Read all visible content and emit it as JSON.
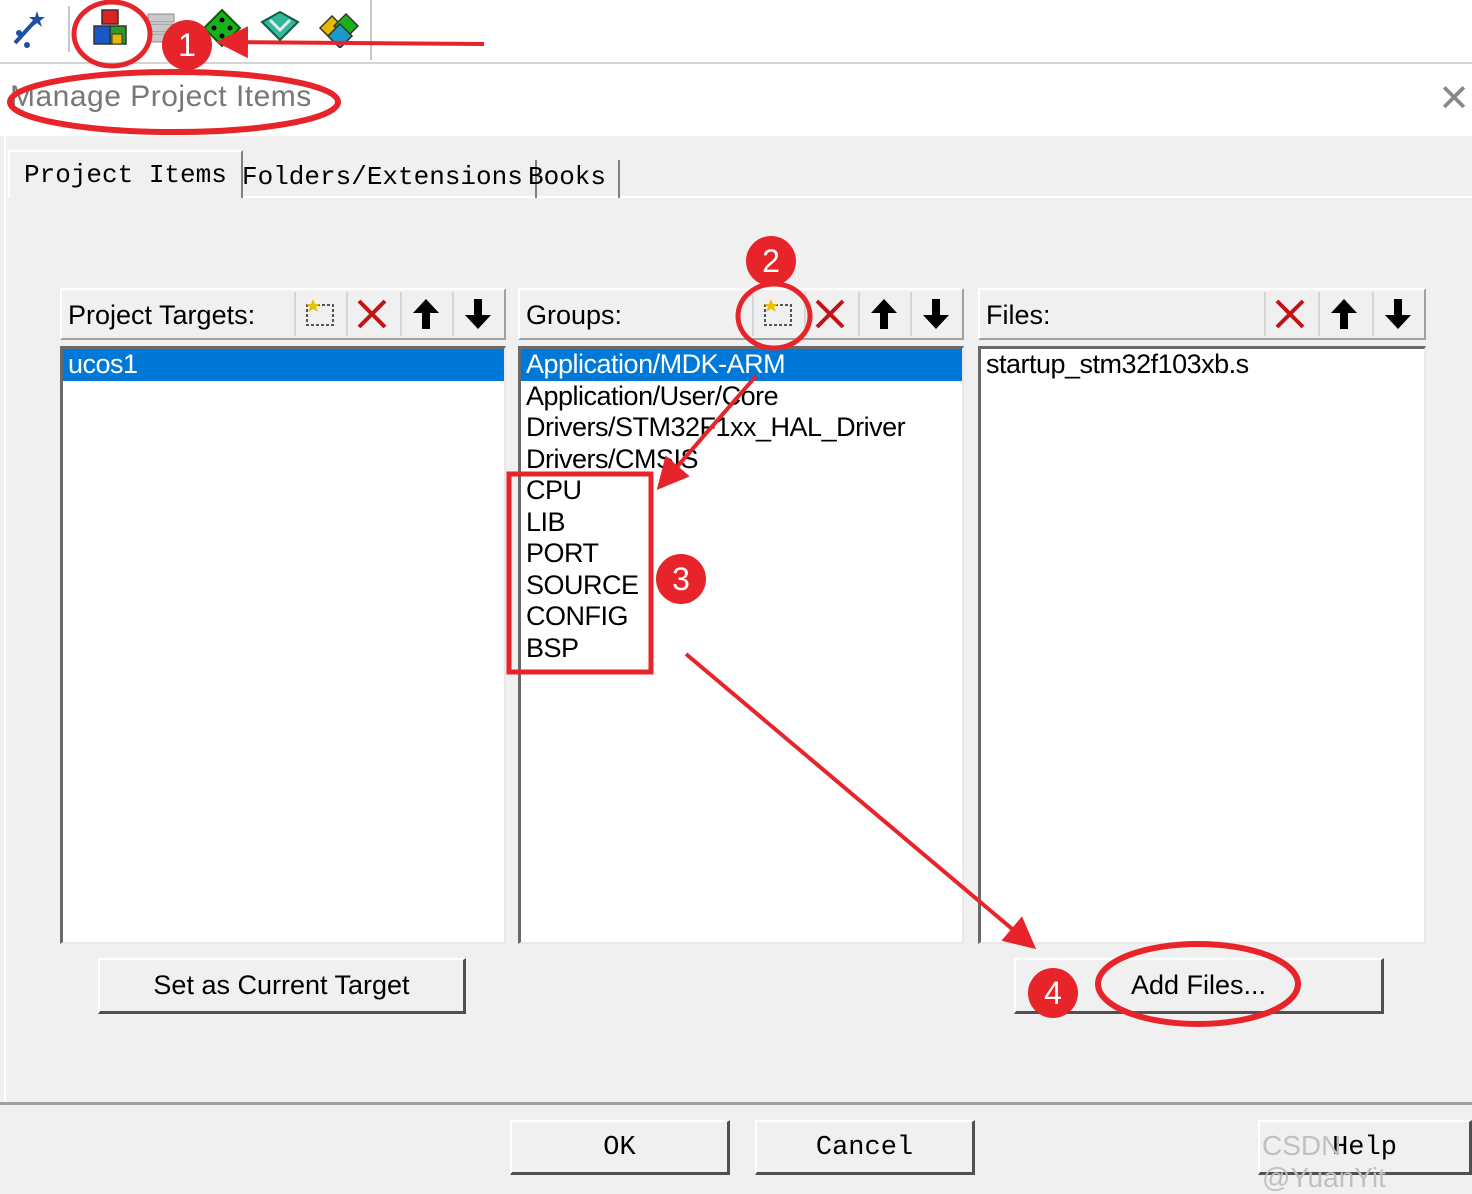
{
  "toolbar": {
    "icons": [
      "magic-wand-icon",
      "manage-project-items-icon",
      "stacked-windows-icon",
      "green-diamond-icon",
      "download-diamond-icon",
      "multi-diamond-icon"
    ]
  },
  "dialog": {
    "title": "Manage Project Items",
    "close_label": "✕"
  },
  "tabs": [
    {
      "label": "Project Items",
      "active": true
    },
    {
      "label": "Folders/Extensions",
      "active": false
    },
    {
      "label": "Books",
      "active": false
    }
  ],
  "targets": {
    "label": "Project Targets:",
    "items": [
      "ucos1"
    ],
    "selected": "ucos1",
    "button": "Set as Current Target"
  },
  "groups": {
    "label": "Groups:",
    "items": [
      "Application/MDK-ARM",
      "Application/User/Core",
      "Drivers/STM32F1xx_HAL_Driver",
      "Drivers/CMSIS",
      "CPU",
      "LIB",
      "PORT",
      "SOURCE",
      "CONFIG",
      "BSP"
    ],
    "selected": "Application/MDK-ARM"
  },
  "files": {
    "label": "Files:",
    "items": [
      "startup_stm32f103xb.s"
    ],
    "button": "Add Files..."
  },
  "footer": {
    "ok": "OK",
    "cancel": "Cancel",
    "help": "Help"
  },
  "annotations": {
    "step1": "1",
    "step2": "2",
    "step3": "3",
    "step4": "4",
    "color": "#e8242b"
  },
  "watermark": "CSDN @YuanYit"
}
